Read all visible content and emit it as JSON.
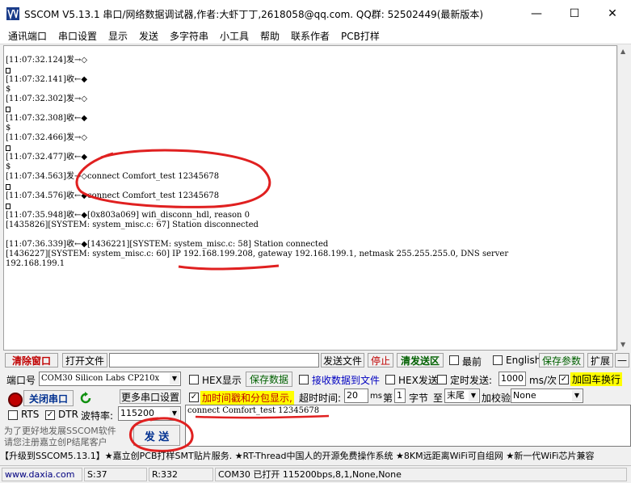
{
  "window": {
    "title": "SSCOM V5.13.1 串口/网络数据调试器,作者:大虾丁丁,2618058@qq.com. QQ群: 52502449(最新版本)",
    "minimize": "—",
    "maximize": "☐",
    "close": "✕"
  },
  "menu": [
    "通讯端口",
    "串口设置",
    "显示",
    "发送",
    "多字符串",
    "小工具",
    "帮助",
    "联系作者",
    "PCB打样"
  ],
  "log": [
    {
      "text": "[11:07:32.124]发→◇"
    },
    {
      "text": "[11:07:32.141]收←◆"
    },
    {
      "text": "$"
    },
    {
      "text": "[11:07:32.302]发→◇"
    },
    {
      "text": "[11:07:32.308]收←◆"
    },
    {
      "text": "$"
    },
    {
      "text": "[11:07:32.466]发→◇"
    },
    {
      "text": "[11:07:32.477]收←◆"
    },
    {
      "text": "$"
    },
    {
      "text": "[11:07:34.563]发→◇connect Comfort_test 12345678"
    },
    {
      "text": "[11:07:34.576]收←◆connect Comfort_test 12345678"
    },
    {
      "text": "[11:07:35.948]收←◆[0x803a069] wifi_disconn_hdl, reason 0"
    },
    {
      "text": "[1435826][SYSTEM: system_misc.c:  67] Station disconnected"
    },
    {
      "text": "[11:07:36.339]收←◆[1436221][SYSTEM: system_misc.c:  58] Station connected"
    },
    {
      "text": "[1436227][SYSTEM: system_misc.c:  60] IP 192.168.199.208, gateway 192.168.199.1, netmask 255.255.255.0, DNS server"
    },
    {
      "text": "192.168.199.1"
    }
  ],
  "row1": {
    "clear_btn": "清除窗口",
    "open_file_btn": "打开文件",
    "file_path": "",
    "send_file_btn": "发送文件",
    "stop_btn": "停止",
    "clear_send_btn": "清发送区",
    "front_label": "最前",
    "english_label": "English",
    "save_params_btn": "保存参数",
    "expand_btn": "扩展",
    "collapse_btn": "—"
  },
  "row2": {
    "port_label": "端口号",
    "port_value": "COM30 Silicon Labs CP210x",
    "hex_display_label": "HEX显示",
    "save_data_btn": "保存数据",
    "recv_to_file_label": "接收数据到文件",
    "hex_send_label": "HEX发送",
    "timed_send_label": "定时发送:",
    "interval_value": "1000",
    "interval_unit": "ms/次",
    "add_crlf_label": "加回车换行"
  },
  "row3": {
    "close_port_btn": "关闭串口",
    "more_settings_btn": "更多串口设置",
    "timestamp_label": "加时间戳和分包显示,",
    "timeout_label": "超时时间:",
    "timeout_value": "20",
    "timeout_unit": "ms",
    "seq_label": "第",
    "seq_value": "1",
    "byte_label": "字节",
    "to_label": "至",
    "to_value": "末尾",
    "checksum_label": "加校验",
    "checksum_value": "None"
  },
  "row4": {
    "rts_label": "RTS",
    "dtr_label": "DTR",
    "baud_label": "波特率:",
    "baud_value": "115200",
    "send_text": "connect Comfort_test 12345678",
    "send_btn": "发 送",
    "promo_line1": "为了更好地发展SSCOM软件",
    "promo_line2": "请您注册嘉立创P结尾客户"
  },
  "ticker": "【升级到SSCOM5.13.1】★嘉立创PCB打样SMT贴片服务. ★RT-Thread中国人的开源免费操作系统 ★8KM远距离WiFi可自组网 ★新一代WiFi芯片兼容",
  "status": {
    "site": "www.daxia.com",
    "sent": "S:37",
    "received": "R:332",
    "port_state": "COM30 已打开  115200bps,8,1,None,None"
  }
}
